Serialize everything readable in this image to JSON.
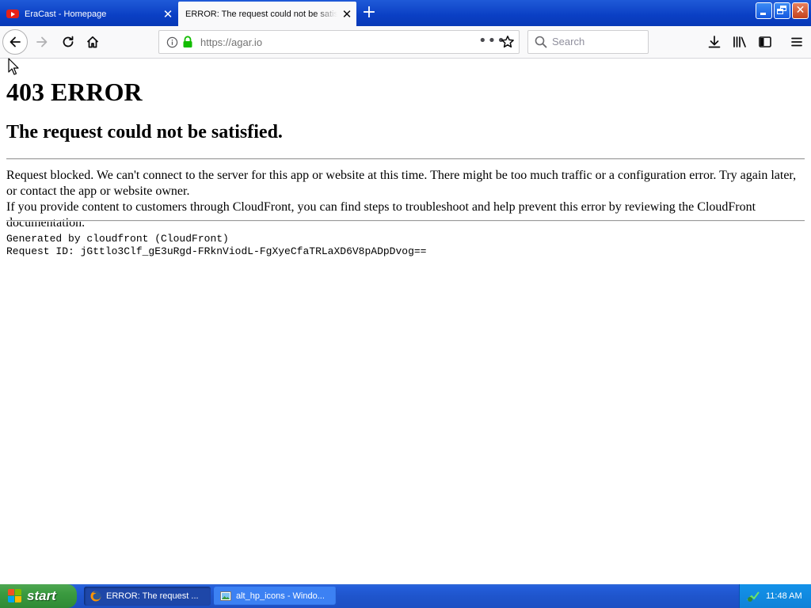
{
  "browser": {
    "tabs": [
      {
        "title": "EraCast - Homepage",
        "favicon": "youtube-icon",
        "active": false
      },
      {
        "title": "ERROR: The request could not be satisfied",
        "active": true
      }
    ],
    "url": "https://agar.io",
    "search_placeholder": "Search",
    "icons": [
      "back-icon",
      "forward-icon",
      "reload-icon",
      "home-icon",
      "info-icon",
      "lock-icon",
      "page-actions-icon",
      "bookmark-star-icon",
      "search-icon",
      "downloads-icon",
      "library-icon",
      "sidebar-icon",
      "menu-icon"
    ]
  },
  "page": {
    "heading": "403 ERROR",
    "subheading": "The request could not be satisfied.",
    "paragraph1": "Request blocked. We can't connect to the server for this app or website at this time. There might be too much traffic or a configuration error. Try again later, or contact the app or website owner.",
    "paragraph2": "If you provide content to customers through CloudFront, you can find steps to troubleshoot and help prevent this error by reviewing the CloudFront documentation.",
    "generated_by": "Generated by cloudfront (CloudFront)",
    "request_id": "Request ID: jGttlo3Clf_gE3uRgd-FRknViodL-FgXyeCfaTRLaXD6V8pADpDvog=="
  },
  "taskbar": {
    "start_label": "start",
    "tasks": [
      {
        "label": "ERROR: The request ...",
        "icon": "firefox-icon",
        "active": true
      },
      {
        "label": "alt_hp_icons - Windo...",
        "icon": "image-viewer-icon",
        "active": false
      }
    ],
    "clock": "11:48 AM"
  },
  "colors": {
    "titlebar": "#0a3fc4",
    "toolbar": "#f9f9fa",
    "lock_green": "#12bc00",
    "taskbar": "#245edb",
    "start_green": "#3a9a3f",
    "tray": "#0f82d8"
  }
}
